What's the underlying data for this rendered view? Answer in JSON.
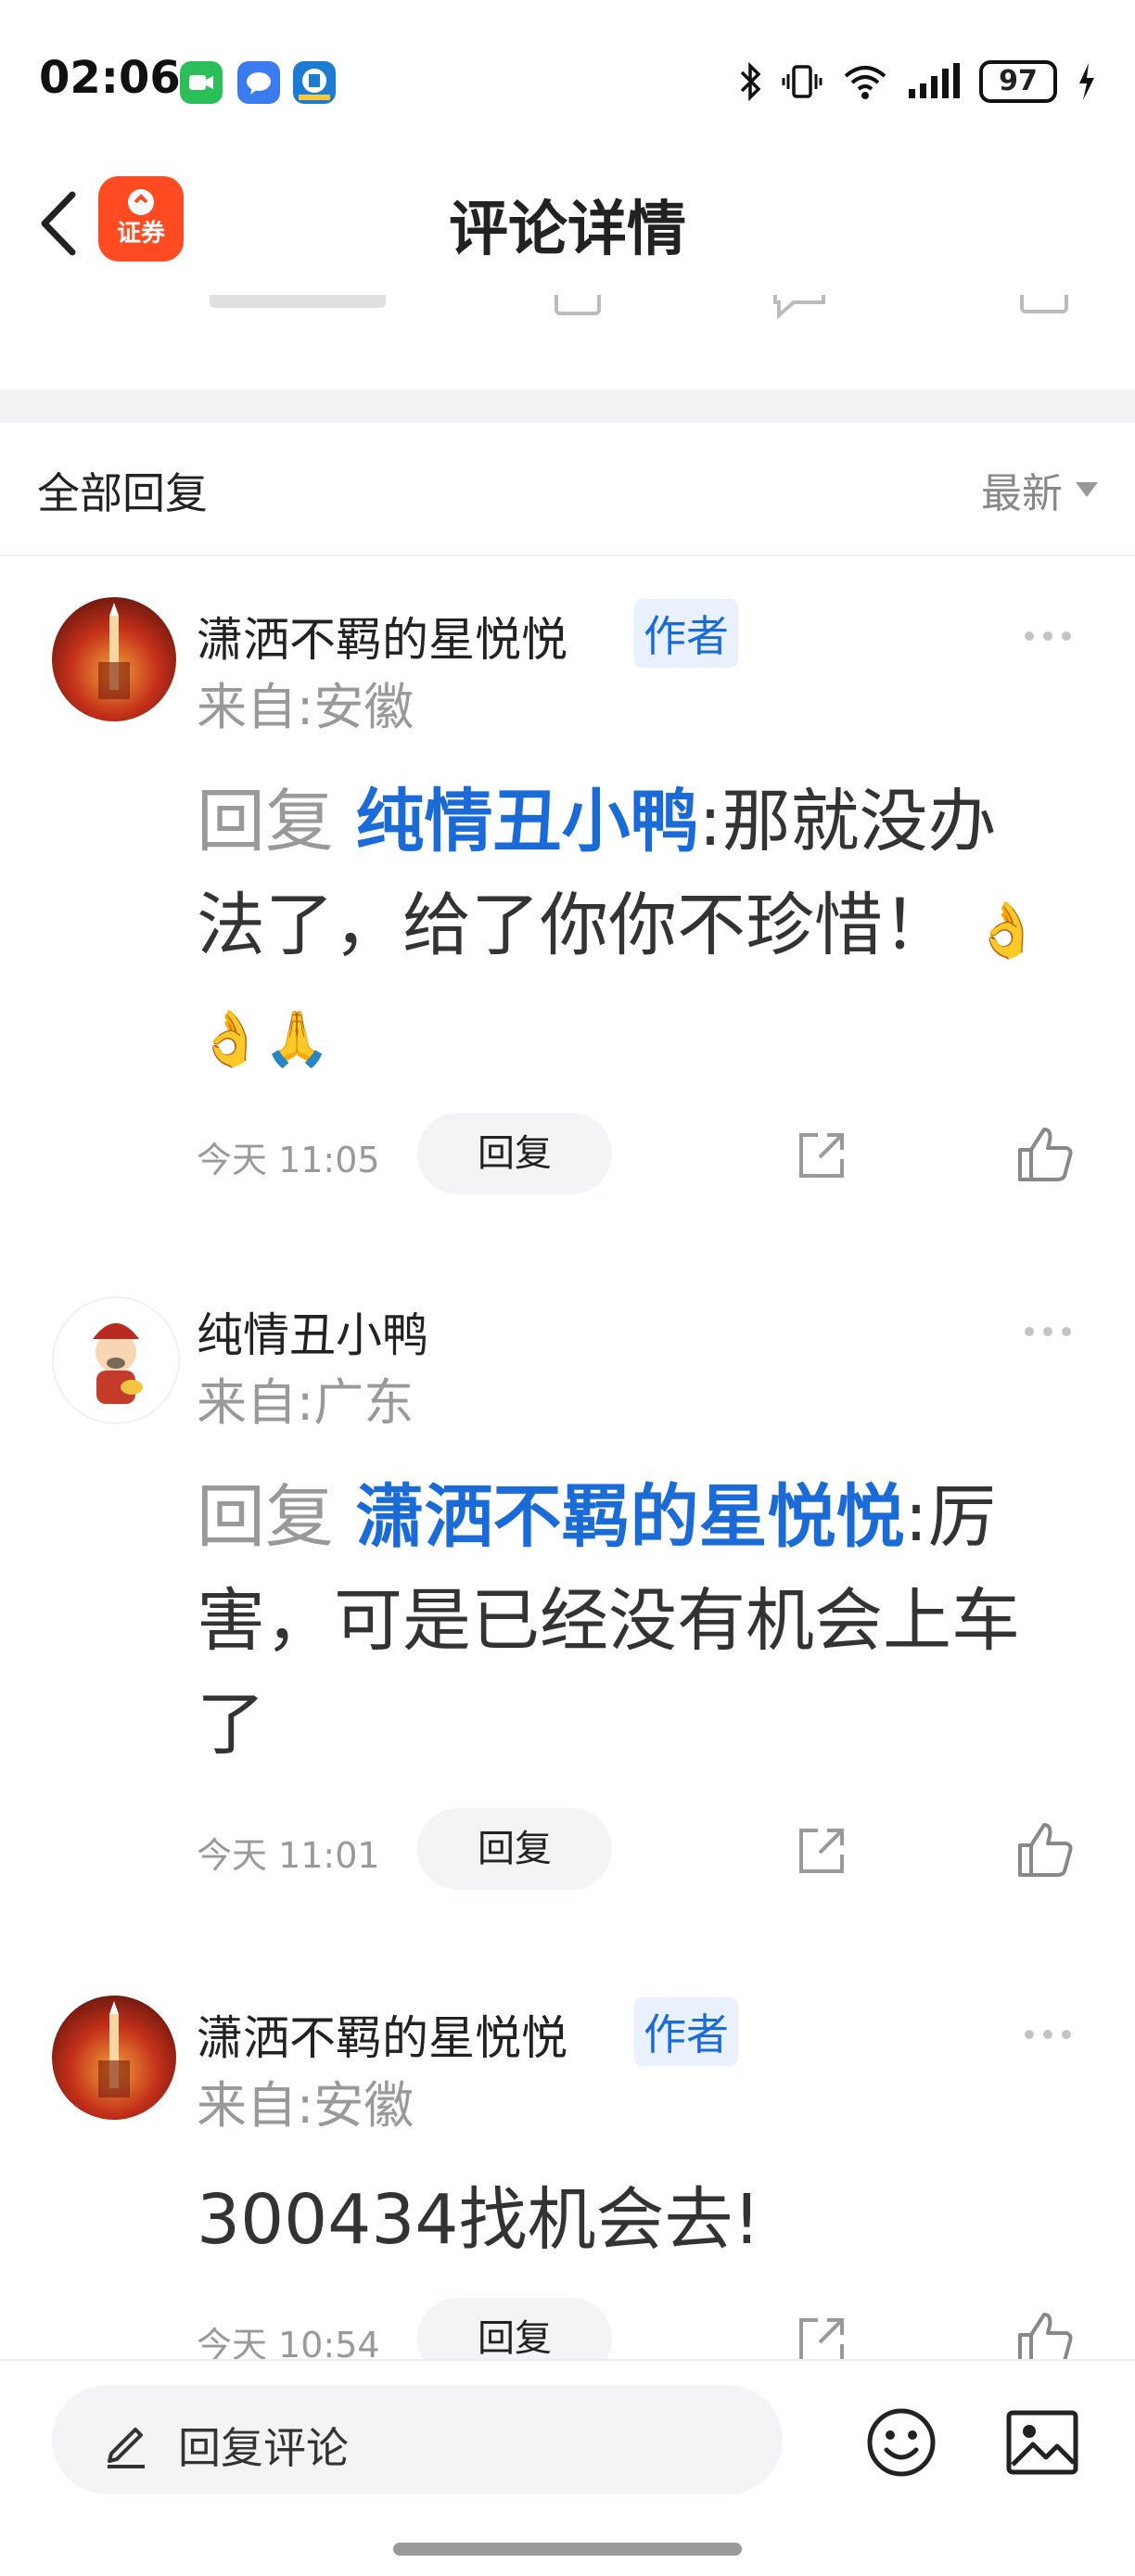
{
  "status_bar": {
    "time": "02:06",
    "battery": "97"
  },
  "header": {
    "app_badge": "证券",
    "title": "评论详情"
  },
  "filter": {
    "all_replies": "全部回复",
    "sort": "最新"
  },
  "replies": [
    {
      "user": "潇洒不羁的星悦悦",
      "tag": "作者",
      "location": "来自:安徽",
      "reply_prefix": "回复",
      "reply_to": "纯情丑小鸭",
      "text": ":那就没办法了，给了你你不珍惜！",
      "emojis": "👌👌🙏",
      "time": "今天 11:05",
      "reply_label": "回复"
    },
    {
      "user": "纯情丑小鸭",
      "tag": "",
      "location": "来自:广东",
      "reply_prefix": "回复",
      "reply_to": "潇洒不羁的星悦悦",
      "text": ":厉害，可是已经没有机会上车了",
      "emojis": "",
      "time": "今天 11:01",
      "reply_label": "回复"
    },
    {
      "user": "潇洒不羁的星悦悦",
      "tag": "作者",
      "location": "来自:安徽",
      "reply_prefix": "",
      "reply_to": "",
      "text": "300434找机会去!",
      "emojis": "",
      "time": "今天 10:54",
      "reply_label": "回复"
    }
  ],
  "bottom": {
    "input_placeholder": "回复评论"
  },
  "icons": [
    "back-icon",
    "pen-icon",
    "emoji-icon",
    "image-icon",
    "share-icon",
    "like-icon",
    "more-icon"
  ],
  "colors": {
    "accent": "#1a6bd8",
    "app_red": "#ff4a22",
    "muted": "#999999"
  }
}
